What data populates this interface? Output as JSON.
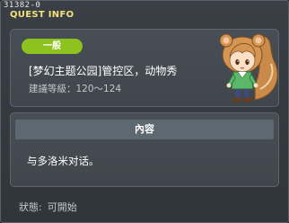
{
  "window": {
    "quest_id": "31382-0",
    "title": "QUEST INFO"
  },
  "quest": {
    "badge": "一般",
    "name": "[梦幻主题公园]管控区，动物秀",
    "level_label": "建議等級：120～124"
  },
  "content": {
    "header": "內容",
    "text": "与多洛米对话。"
  },
  "status": {
    "label": "狀態:",
    "value": "可開始"
  },
  "colors": {
    "title": "#f2e27a",
    "badge": "#8dc21f",
    "panel": "#484e55"
  },
  "icons": {
    "npc": "npc-portrait-squirrel-girl",
    "close": "close-icon"
  }
}
